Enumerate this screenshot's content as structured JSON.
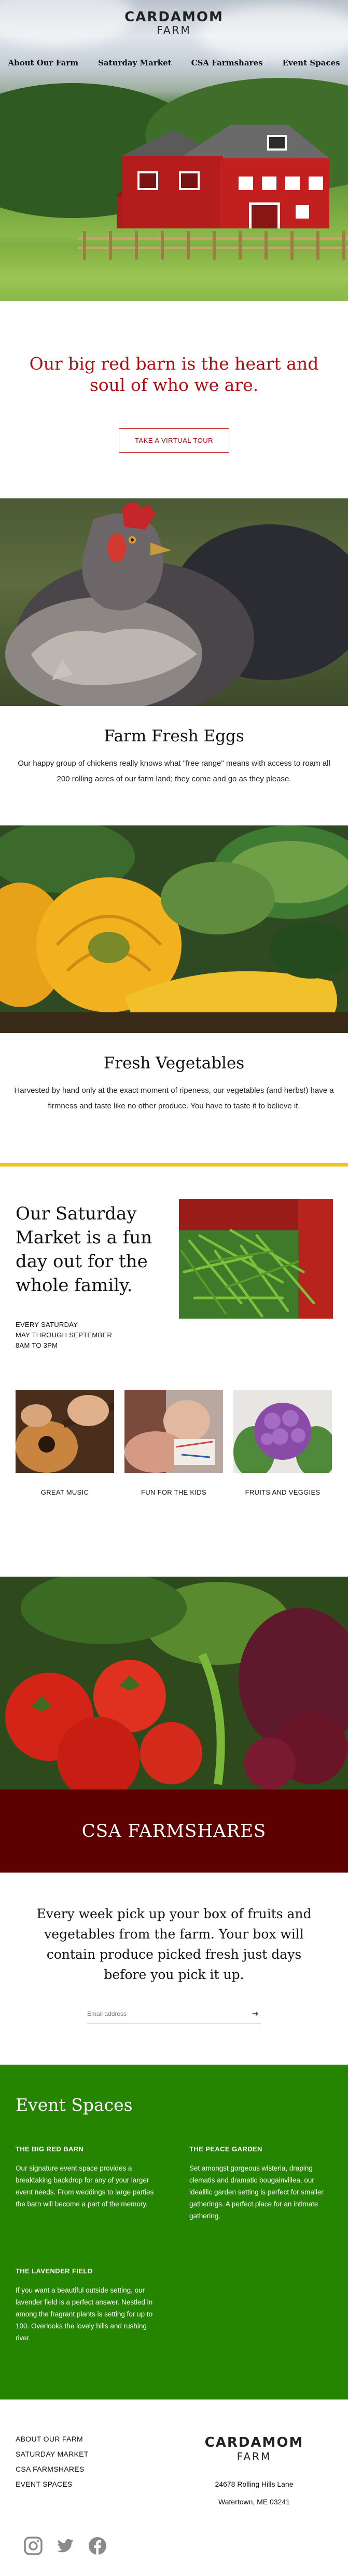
{
  "brand": {
    "name_top": "CARDAMOM",
    "name_bottom": "FARM"
  },
  "nav": {
    "items": [
      "About Our Farm",
      "Saturday Market",
      "CSA Farmshares",
      "Event Spaces"
    ]
  },
  "intro": {
    "headline": "Our big red barn is the heart and soul of who we are.",
    "button_label": "TAKE A VIRTUAL TOUR"
  },
  "eggs": {
    "title": "Farm Fresh Eggs",
    "body": "Our happy group of chickens really knows what \"free range\" means with access to roam all 200 rolling acres of our farm land; they come and go as they please."
  },
  "vegetables": {
    "title": "Fresh Vegetables",
    "body": "Harvested by hand only at the exact moment of ripeness, our vegetables (and herbs!) have a firmness and taste like no other produce. You have to taste it to believe it."
  },
  "saturday": {
    "title": "Our Saturday Market is a fun day out for the whole family.",
    "when_line1": "EVERY SATURDAY",
    "when_line2": "MAY THROUGH SEPTEMBER",
    "when_line3": "8AM TO 3PM",
    "tiles": [
      "GREAT MUSIC",
      "FUN FOR THE KIDS",
      "FRUITS AND VEGGIES"
    ]
  },
  "csa": {
    "banner": "CSA FARMSHARES",
    "body": "Every week pick up your box of fruits and vegetables from the farm. Your box will contain produce picked fresh just days before you pick it up.",
    "email_placeholder": "Email address"
  },
  "events": {
    "title": "Event Spaces",
    "items": [
      {
        "name": "THE BIG RED BARN",
        "desc": "Our signature event space provides a breaktaking backdrop for any of your larger event needs. From weddings to large parties the barn will become a part of the memory."
      },
      {
        "name": "THE PEACE GARDEN",
        "desc": "Set amongst gorgeous wisteria, draping clematis and dramatic bougainvillea, our idealllic garden setting is perfect for smaller gatherings. A perfect place for an intimate gathering."
      },
      {
        "name": "THE LAVENDER FIELD",
        "desc": "If you want a beautiful outside setting, our lavender field is a perfect answer. Nestled in among the fragrant plants is setting for up to 100. Overlooks the lovely hills and rushing river."
      }
    ]
  },
  "footer": {
    "links": [
      "ABOUT OUR FARM",
      "SATURDAY MARKET",
      "CSA FARMSHARES",
      "EVENT SPACES"
    ],
    "address_line1": "24678 Rolling Hills Lane",
    "address_line2": "Watertown, ME 03241",
    "social_icons": [
      "instagram-icon",
      "twitter-icon",
      "facebook-icon"
    ]
  },
  "colors": {
    "brand_red": "#b00c12",
    "csa_band": "#5c0000",
    "events_green": "#258400",
    "divider_yellow": "#f2c418"
  }
}
